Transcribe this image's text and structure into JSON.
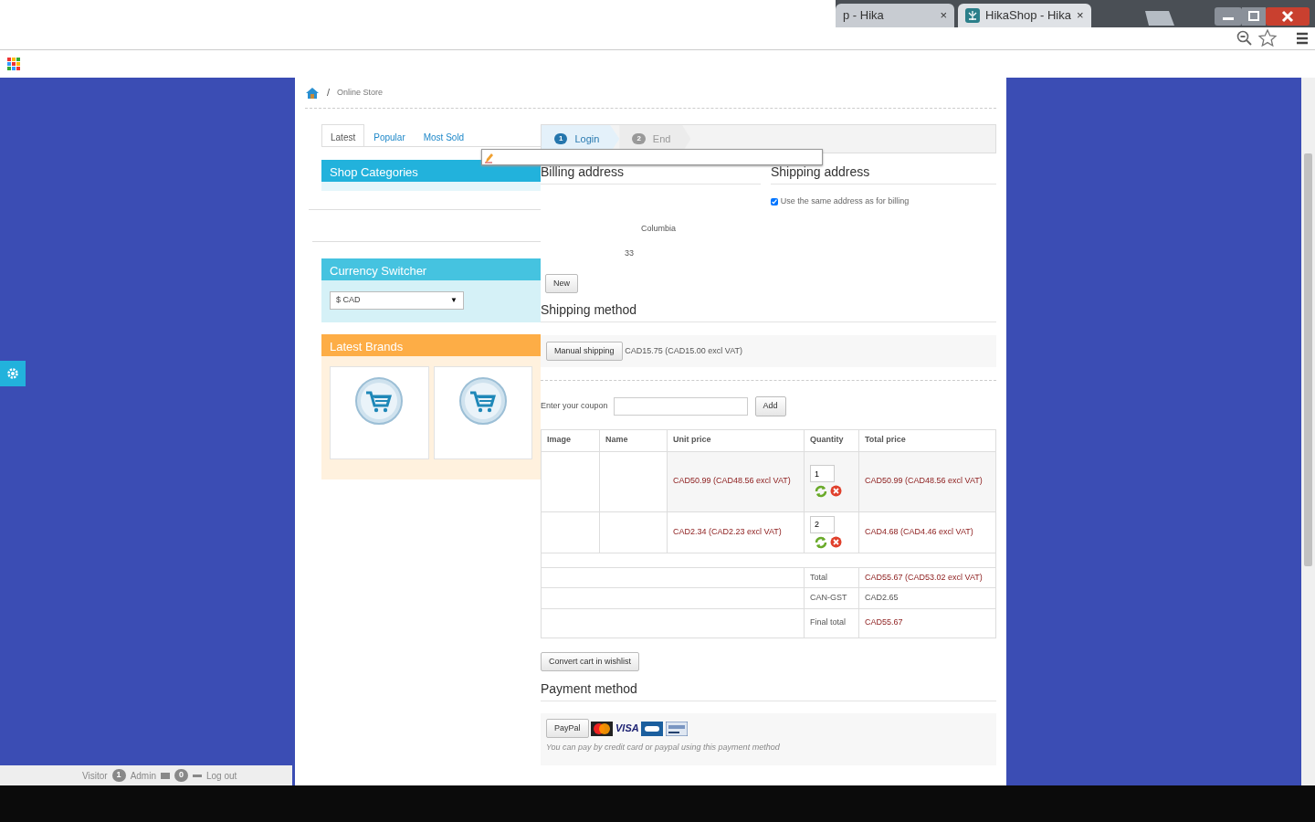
{
  "browser": {
    "tabs": [
      {
        "label": "p - Hika",
        "selected": false
      },
      {
        "label": "HikaShop - Hika",
        "selected": true
      }
    ],
    "close_glyph": "×"
  },
  "breadcrumb": {
    "separator": "/",
    "items": [
      "Online Store"
    ]
  },
  "product_tabs": [
    {
      "label": "Latest",
      "selected": true
    },
    {
      "label": "Popular",
      "selected": false
    },
    {
      "label": "Most Sold",
      "selected": false
    }
  ],
  "modules": [
    {
      "kind": "categories",
      "title": "Shop Categories"
    },
    {
      "kind": "currency",
      "title": "Currency Switcher",
      "value": "$ CAD",
      "caret": "▼"
    },
    {
      "kind": "brands",
      "title": "Latest Brands",
      "brand_cards": [
        {
          "kind": "cart"
        },
        {
          "kind": "cart"
        }
      ]
    }
  ],
  "checkout_steps": [
    {
      "number": "1",
      "label": "Login",
      "selected": true
    },
    {
      "number": "2",
      "label": "End",
      "selected": false
    }
  ],
  "billing": {
    "title": "Billing address",
    "lines": [
      "Columbia",
      "33"
    ],
    "new_button": "New"
  },
  "shipping_address": {
    "title": "Shipping address",
    "same_as_billing": {
      "label": "Use the same address as for billing",
      "checked": true
    }
  },
  "shipping_method": {
    "title": "Shipping method",
    "option_button": "Manual shipping",
    "price": "CAD15.75 (CAD15.00 excl VAT)"
  },
  "coupon": {
    "label": "Enter your coupon",
    "button": "Add"
  },
  "cart": {
    "columns": [
      "Image",
      "Name",
      "Unit price",
      "Quantity",
      "Total price"
    ],
    "rows": [
      {
        "unit_price": "CAD50.99 (CAD48.56 excl VAT)",
        "quantity": "1",
        "total_price": "CAD50.99 (CAD48.56 excl VAT)"
      },
      {
        "unit_price": "CAD2.34 (CAD2.23 excl VAT)",
        "quantity": "2",
        "total_price": "CAD4.68 (CAD4.46 excl VAT)"
      }
    ],
    "totals": [
      {
        "label": "Total",
        "value": "CAD55.67 (CAD53.02 excl VAT)",
        "highlight": true
      },
      {
        "label": "CAN-GST",
        "value": "CAD2.65",
        "highlight": false
      },
      {
        "label": "Final total",
        "value": "CAD55.67",
        "highlight": true
      }
    ]
  },
  "wishlist_button": "Convert cart in wishlist",
  "payment": {
    "title": "Payment method",
    "option_button": "PayPal",
    "logos": [
      {
        "kind": "mastercard"
      },
      {
        "kind": "visa",
        "text": "VISA"
      },
      {
        "kind": "cb"
      },
      {
        "kind": "paypal"
      }
    ],
    "description": "You can pay by credit card or paypal using this payment method"
  },
  "admin_bar": {
    "visitor_label": "Visitor",
    "admin_badge": "1",
    "admin_label": "Admin",
    "messages_badge": "0",
    "logout": "Log out"
  }
}
